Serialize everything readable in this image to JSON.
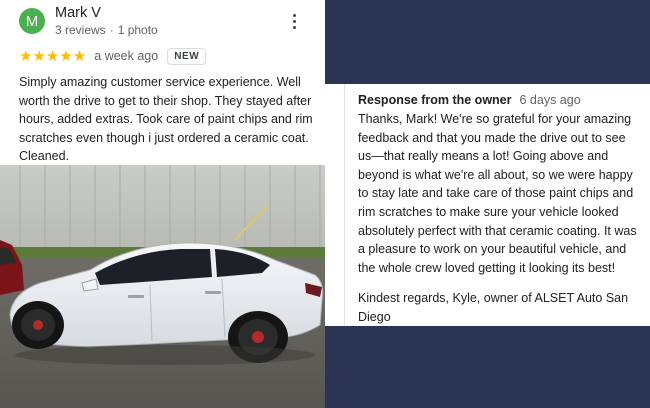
{
  "colors": {
    "avatar_accent": "#4caf50",
    "star": "#fbbc04",
    "background_navy": "#2b3452"
  },
  "review": {
    "avatar_letter": "M",
    "reviewer_name": "Mark V",
    "reviews_count": "3 reviews",
    "separator": "·",
    "photos_count": "1 photo",
    "more_icon": "more-vert-icon",
    "rating": 5,
    "time": "a week ago",
    "badge": "NEW",
    "text": "Simply amazing customer service experience.  Well worth the drive to get to their shop.  They stayed after hours, added extras.  Took care of paint chips and rim scratches even though i just ordered a ceramic coat.  Cleaned."
  },
  "photo": {
    "subject": "white-car-photo"
  },
  "response": {
    "title": "Response from the owner",
    "time": "6 days ago",
    "text": "Thanks, Mark! We're so grateful for your amazing feedback and that you made the drive out to see us—that really means a lot! Going above and beyond is what we're all about, so we were happy to stay late and take care of those paint chips and rim scratches to make sure your vehicle looked absolutely perfect with that ceramic coating. It was a pleasure to work on your beautiful vehicle, and the whole crew loved getting it looking its best!",
    "signature": "Kindest regards, Kyle, owner of ALSET Auto San Diego"
  }
}
